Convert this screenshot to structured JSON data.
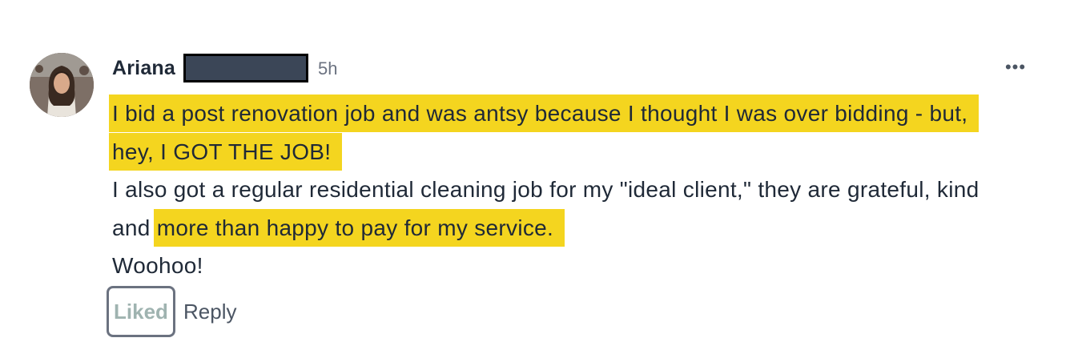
{
  "post": {
    "author_name": "Ariana",
    "timestamp": "5h",
    "more_menu_label": "•••",
    "body": {
      "highlight_1": "I bid a post renovation job and was antsy because I thought I was over bidding - but, hey, I GOT THE JOB!",
      "text_1": "I also got a regular residential cleaning job for my \"ideal client,\" they are grateful, kind and",
      "highlight_2": "more than happy to pay for my service.",
      "text_2": "Woohoo!"
    },
    "actions": {
      "liked_label": "Liked",
      "reply_label": "Reply"
    },
    "colors": {
      "highlight": "#f4d51f",
      "text": "#1f2937",
      "muted": "#6b7280",
      "liked_text": "#9fb3b0"
    }
  }
}
